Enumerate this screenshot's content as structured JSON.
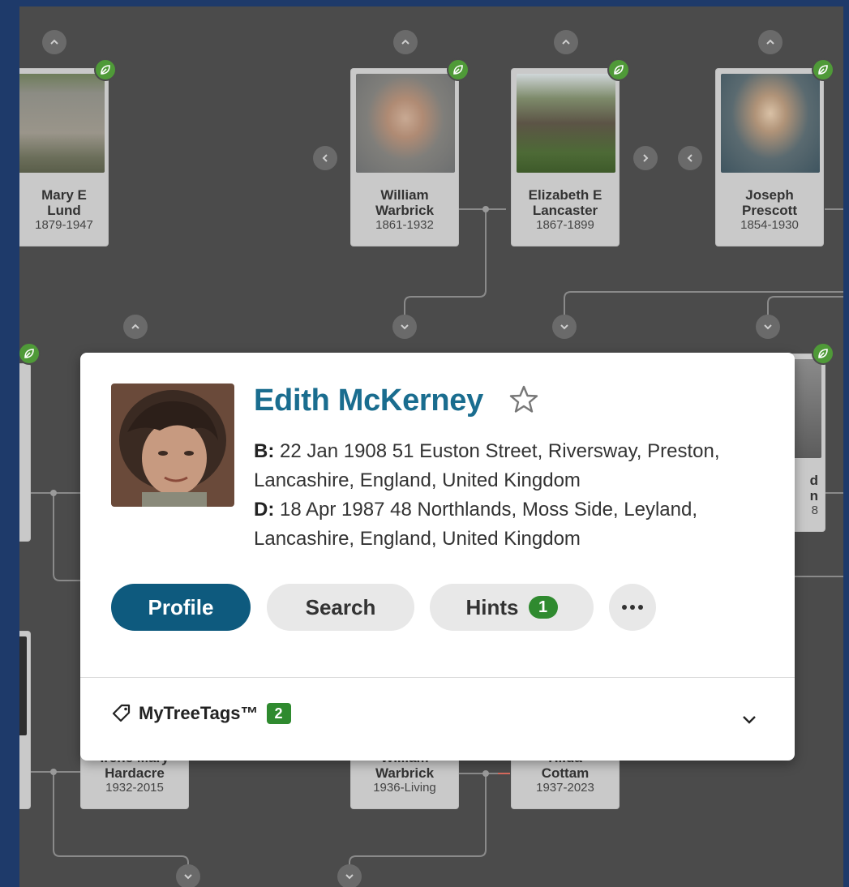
{
  "colors": {
    "accent_blue": "#1a6d8f",
    "profile_button": "#0e5a7e",
    "hint_green": "#4f9a38",
    "canvas_bg": "#4b4b4b",
    "frame_bg": "#1e3a6a"
  },
  "tree": {
    "people": [
      {
        "id": "mary",
        "name": "Mary E\nLund",
        "dates": "1879-1947"
      },
      {
        "id": "william1",
        "name": "William\nWarbrick",
        "dates": "1861-1932"
      },
      {
        "id": "elizabeth",
        "name": "Elizabeth E\nLancaster",
        "dates": "1867-1899"
      },
      {
        "id": "joseph",
        "name": "Joseph\nPrescott",
        "dates": "1854-1930"
      },
      {
        "id": "irene",
        "name": "Irene Mary\nHardacre",
        "dates": "1932-2015"
      },
      {
        "id": "william2",
        "name": "William\nWarbrick",
        "dates": "1936-Living"
      },
      {
        "id": "hilda",
        "name": "Hilda\nCottam",
        "dates": "1937-2023"
      },
      {
        "id": "partial-right",
        "name": "d\nn",
        "dates": "8"
      }
    ]
  },
  "popover": {
    "name": "Edith McKerney",
    "birth_label": "B:",
    "birth_text": " 22 Jan 1908 51 Euston Street, Riversway, Preston, Lancashire, England, United Kingdom",
    "death_label": "D:",
    "death_text": " 18 Apr 1987 48 Northlands, Moss Side, Leyland, Lancashire, England, United Kingdom",
    "buttons": {
      "profile": "Profile",
      "search": "Search",
      "hints": "Hints",
      "hints_count": "1"
    },
    "tags_label": "MyTreeTags™",
    "tags_count": "2"
  },
  "icons": [
    "chevron-up-icon",
    "chevron-down-icon",
    "chevron-left-icon",
    "chevron-right-icon",
    "leaf-icon",
    "star-icon",
    "more-icon",
    "tag-icon"
  ]
}
